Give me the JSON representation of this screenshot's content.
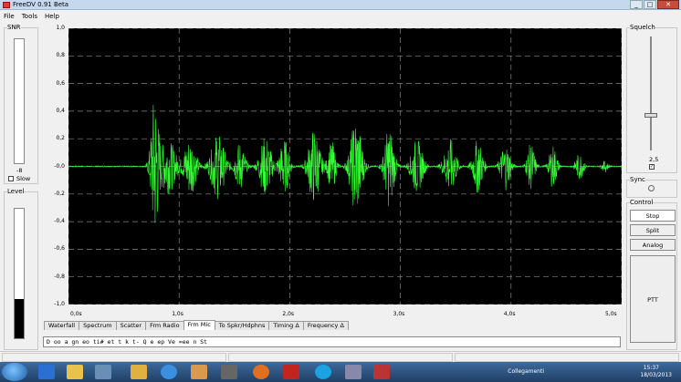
{
  "window": {
    "title": "FreeDV 0.91 Beta",
    "min": "_",
    "max": "□",
    "close": "✕"
  },
  "menu": [
    "File",
    "Tools",
    "Help"
  ],
  "snr": {
    "title": "SNR",
    "value": "-8",
    "slow_label": "Slow",
    "slow_checked": false
  },
  "level": {
    "title": "Level",
    "fill_fraction": 0.3
  },
  "squelch": {
    "title": "Squelch",
    "value": "2,5",
    "checked": true,
    "slider_fraction": 0.33
  },
  "sync": {
    "title": "Sync"
  },
  "control": {
    "title": "Control",
    "stop": "Stop",
    "split": "Split",
    "analog": "Analog",
    "ptt": "PTT"
  },
  "tabs": [
    {
      "label": "Waterfall",
      "active": false
    },
    {
      "label": "Spectrum",
      "active": false
    },
    {
      "label": "Scatter",
      "active": false
    },
    {
      "label": "Frm Radio",
      "active": false
    },
    {
      "label": "Frm Mic",
      "active": true
    },
    {
      "label": "To Spkr/Hdphns",
      "active": false
    },
    {
      "label": "Timing Δ",
      "active": false
    },
    {
      "label": "Frequency Δ",
      "active": false
    }
  ],
  "text_line": "D oo   a gn   eo  ti#    et t k t-    Q e ep  Ve =ee    n St",
  "chart_data": {
    "type": "line",
    "y_ticks": [
      "1,0",
      "0,8",
      "0,6",
      "0,4",
      "0,2",
      "-0,0",
      "-0,2",
      "-0,4",
      "-0,6",
      "-0,8",
      "-1,0"
    ],
    "x_ticks": [
      "0,0s",
      "1,0s",
      "2,0s",
      "3,0s",
      "4,0s",
      "5,0s"
    ],
    "xlim": [
      0,
      5
    ],
    "ylim": [
      -1,
      1
    ],
    "grid": true,
    "line_color": "#33ff33",
    "bursts": [
      {
        "t": 0.78,
        "w": 0.04,
        "a": 0.52
      },
      {
        "t": 0.9,
        "w": 0.08,
        "a": 0.2
      },
      {
        "t": 1.1,
        "w": 0.06,
        "a": 0.22
      },
      {
        "t": 1.35,
        "w": 0.07,
        "a": 0.24
      },
      {
        "t": 1.55,
        "w": 0.05,
        "a": 0.18
      },
      {
        "t": 1.78,
        "w": 0.06,
        "a": 0.22
      },
      {
        "t": 1.95,
        "w": 0.05,
        "a": 0.2
      },
      {
        "t": 2.22,
        "w": 0.06,
        "a": 0.28
      },
      {
        "t": 2.38,
        "w": 0.04,
        "a": 0.18
      },
      {
        "t": 2.6,
        "w": 0.06,
        "a": 0.36
      },
      {
        "t": 2.9,
        "w": 0.05,
        "a": 0.3
      },
      {
        "t": 3.15,
        "w": 0.06,
        "a": 0.2
      },
      {
        "t": 3.45,
        "w": 0.06,
        "a": 0.2
      },
      {
        "t": 3.7,
        "w": 0.05,
        "a": 0.2
      },
      {
        "t": 3.95,
        "w": 0.05,
        "a": 0.17
      },
      {
        "t": 4.18,
        "w": 0.04,
        "a": 0.17
      },
      {
        "t": 4.38,
        "w": 0.04,
        "a": 0.16
      },
      {
        "t": 4.62,
        "w": 0.04,
        "a": 0.1
      },
      {
        "t": 4.85,
        "w": 0.03,
        "a": 0.04
      }
    ]
  },
  "tray": {
    "label": "Collegamenti",
    "time": "15:37",
    "date": "18/03/2013"
  }
}
